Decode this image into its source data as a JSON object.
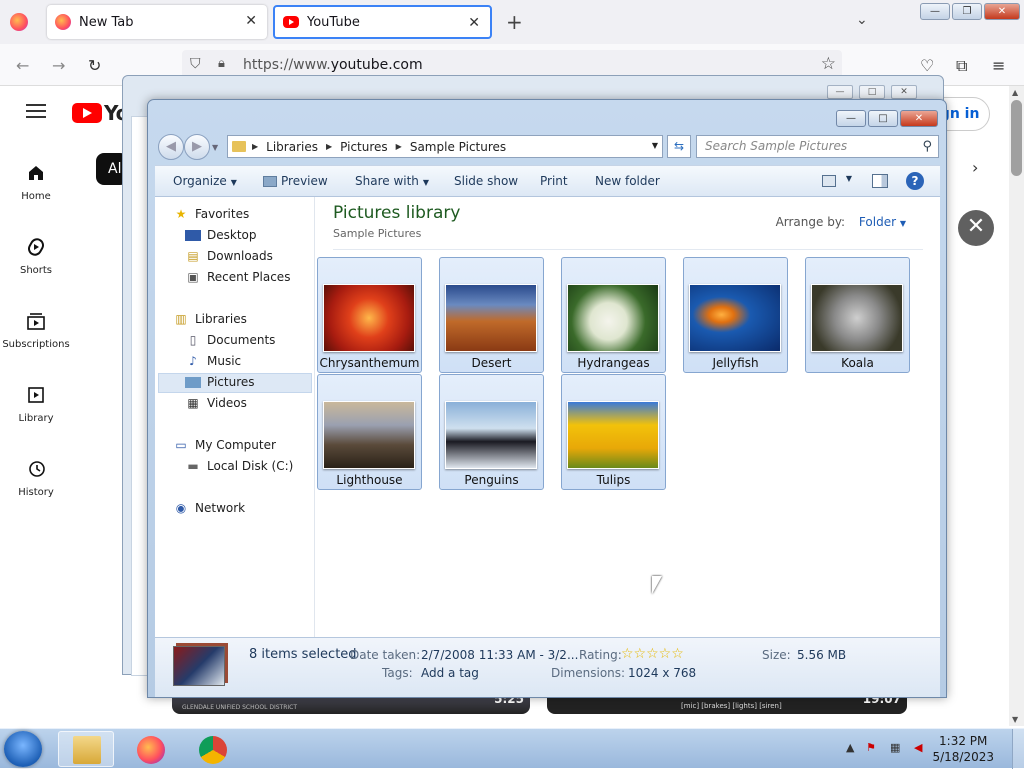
{
  "browser": {
    "tabs": [
      {
        "label": "New Tab"
      },
      {
        "label": "YouTube"
      }
    ],
    "new_tab_symbol": "+",
    "url_prefix": "https://www.",
    "url_host": "youtube.com",
    "window_buttons": [
      "—",
      "❐",
      "✕"
    ]
  },
  "youtube": {
    "logo_text": "Yo",
    "sidebar": [
      {
        "label": "Home",
        "icon": "home-icon"
      },
      {
        "label": "Shorts",
        "icon": "shorts-icon"
      },
      {
        "label": "Subscriptions",
        "icon": "subscriptions-icon"
      },
      {
        "label": "Library",
        "icon": "library-icon"
      },
      {
        "label": "History",
        "icon": "history-icon"
      }
    ],
    "chip_all": "All",
    "sign_in": "ign in",
    "videos": [
      {
        "duration": "5:25",
        "caption": "GLENDALE UNIFIED SCHOOL DISTRICT"
      },
      {
        "duration": "19:07",
        "caption": "[mic] [brakes] [lights] [siren]"
      }
    ]
  },
  "explorer": {
    "breadcrumb": [
      "Libraries",
      "Pictures",
      "Sample Pictures"
    ],
    "search_placeholder": "Search Sample Pictures",
    "toolbar": {
      "organize": "Organize",
      "preview": "Preview",
      "share_with": "Share with",
      "slide_show": "Slide show",
      "print": "Print",
      "new_folder": "New folder"
    },
    "nav": {
      "favorites": "Favorites",
      "desktop": "Desktop",
      "downloads": "Downloads",
      "recent_places": "Recent Places",
      "libraries": "Libraries",
      "documents": "Documents",
      "music": "Music",
      "pictures": "Pictures",
      "videos": "Videos",
      "my_computer": "My Computer",
      "local_disk": "Local Disk (C:)",
      "network": "Network"
    },
    "library_title": "Pictures library",
    "library_subtitle": "Sample Pictures",
    "arrange_label": "Arrange by:",
    "arrange_value": "Folder",
    "files": [
      {
        "name": "Chrysanthemum"
      },
      {
        "name": "Desert"
      },
      {
        "name": "Hydrangeas"
      },
      {
        "name": "Jellyfish"
      },
      {
        "name": "Koala"
      },
      {
        "name": "Lighthouse"
      },
      {
        "name": "Penguins"
      },
      {
        "name": "Tulips"
      }
    ],
    "status": {
      "selected": "8 items selected",
      "date_taken_label": "Date taken:",
      "date_taken_value": "2/7/2008 11:33 AM - 3/2...",
      "rating_label": "Rating:",
      "rating_stars": "☆☆☆☆☆",
      "size_label": "Size:",
      "size_value": "5.56 MB",
      "tags_label": "Tags:",
      "tags_value": "Add a tag",
      "dimensions_label": "Dimensions:",
      "dimensions_value": "1024 x 768"
    }
  },
  "taskbar": {
    "time": "1:32 PM",
    "date": "5/18/2023"
  }
}
